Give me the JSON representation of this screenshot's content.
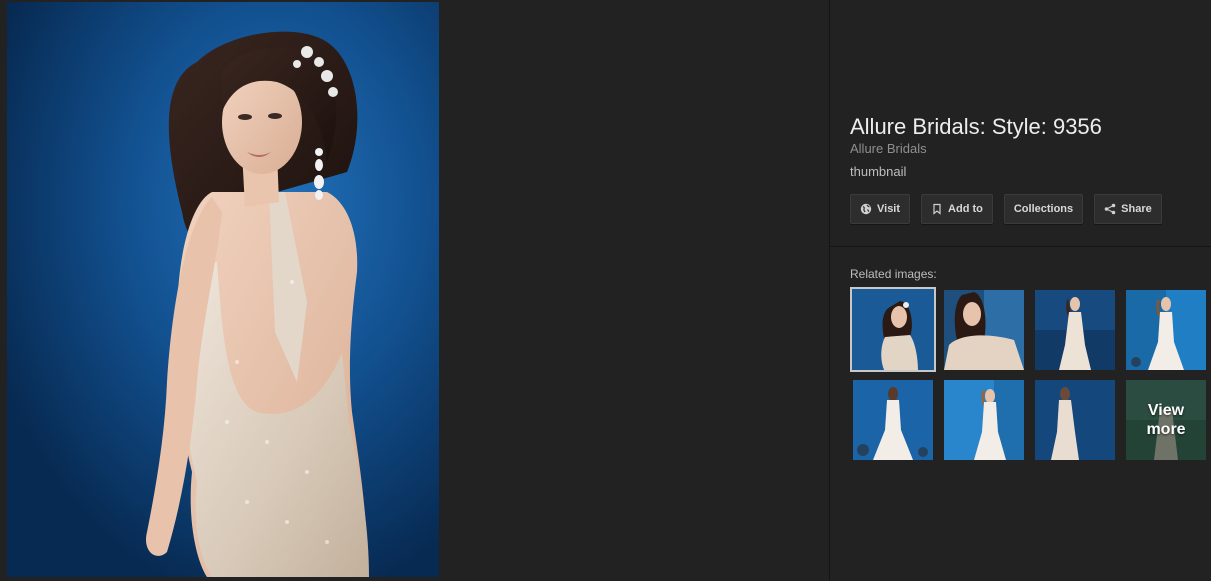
{
  "detail": {
    "title": "Allure Bridals: Style: 9356",
    "source": "Allure Bridals",
    "caption": "thumbnail"
  },
  "actions": {
    "visit": "Visit",
    "add_to": "Add to",
    "collections": "Collections",
    "share": "Share"
  },
  "related": {
    "label": "Related images:",
    "view_more": "View more"
  },
  "icons": {
    "visit": "globe-icon",
    "add_to": "bookmark-icon",
    "share": "share-icon"
  },
  "colors": {
    "background": "#222222",
    "button_bg": "#2d2d2d",
    "title_text": "#ededed",
    "photo_blue": "#12508f"
  }
}
